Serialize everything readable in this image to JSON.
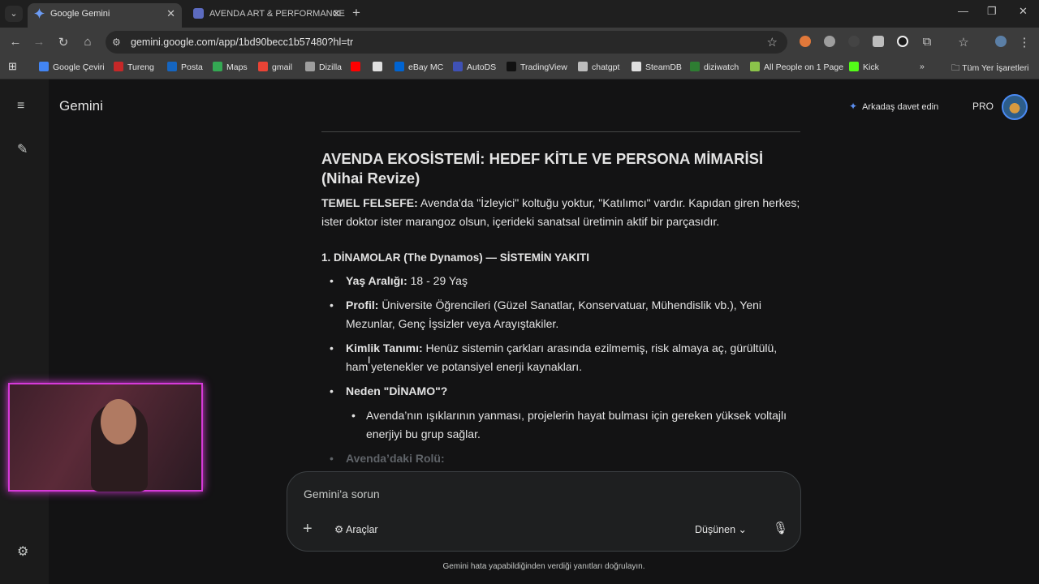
{
  "browser": {
    "tabs": [
      {
        "title": "Google Gemini",
        "active": true
      },
      {
        "title": "AVENDA ART & PERFORMANCE",
        "active": false
      }
    ],
    "url": "gemini.google.com/app/1bd90becc1b57480?hl=tr",
    "bookmarks": [
      {
        "label": "Google Çeviri",
        "color": "#4285f4"
      },
      {
        "label": "Tureng",
        "color": "#c62828"
      },
      {
        "label": "Posta",
        "color": "#1565c0"
      },
      {
        "label": "Maps",
        "color": "#34a853"
      },
      {
        "label": "gmail",
        "color": "#ea4335"
      },
      {
        "label": "Dizilla",
        "color": "#9e9e9e"
      },
      {
        "label": "",
        "color": "#ff0000"
      },
      {
        "label": "",
        "color": "#e0e0e0"
      },
      {
        "label": "eBay MC",
        "color": "#0064d2"
      },
      {
        "label": "AutoDS",
        "color": "#3f51b5"
      },
      {
        "label": "TradingView",
        "color": "#111111"
      },
      {
        "label": "chatgpt",
        "color": "#bdbdbd"
      },
      {
        "label": "SteamDB",
        "color": "#e0e0e0"
      },
      {
        "label": "diziwatch",
        "color": "#2e7d32"
      },
      {
        "label": "All People on 1 Page",
        "color": "#8bc34a"
      },
      {
        "label": "Kick",
        "color": "#53fc18"
      }
    ],
    "overflow_label": "»",
    "all_bookmarks": "Tüm Yer İşaretleri"
  },
  "app": {
    "title": "Gemini",
    "invite_label": "Arkadaş davet edin",
    "plan_badge": "PRO"
  },
  "response": {
    "heading": "AVENDA EKOSİSTEMİ: HEDEF KİTLE VE PERSONA MİMARİSİ (Nihai Revize)",
    "philosophy_label": "TEMEL FELSEFE:",
    "philosophy_text": " Avenda'da \"İzleyici\" koltuğu yoktur, \"Katılımcı\" vardır. Kapıdan giren herkes; ister doktor ister marangoz olsun, içerideki sanatsal üretimin aktif bir parçasıdır.",
    "section_title": "1. DİNAMOLAR (The Dynamos) — SİSTEMİN YAKITI",
    "items": [
      {
        "label": "Yaş Aralığı:",
        "text": " 18 - 29 Yaş"
      },
      {
        "label": "Profil:",
        "text": " Üniversite Öğrencileri (Güzel Sanatlar, Konservatuar, Mühendislik vb.), Yeni Mezunlar, Genç İşsizler veya Arayıştakiler."
      },
      {
        "label": "Kimlik Tanımı:",
        "text": " Henüz sistemin çarkları arasında ezilmemiş, risk almaya aç, gürültülü, ham yetenekler ve potansiyel enerji kaynakları."
      },
      {
        "label": "Neden \"DİNAMO\"?",
        "text": ""
      }
    ],
    "sub_item": "Avenda’nın ışıklarının yanması, projelerin hayat bulması için gereken yüksek voltajlı enerjiyi bu grup sağlar.",
    "faded_item": "Avenda’daki Rolü:"
  },
  "composer": {
    "placeholder": "Gemini'a sorun",
    "tools_label": "Araçlar",
    "mode_label": "Düşünen"
  },
  "disclaimer": "Gemini hata yapabildiğinden verdiği yanıtları doğrulayın."
}
